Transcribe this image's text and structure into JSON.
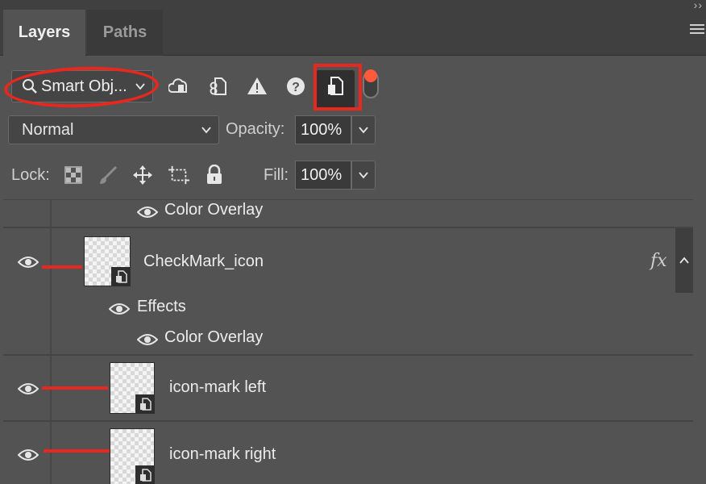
{
  "tabs": [
    {
      "label": "Layers",
      "active": true
    },
    {
      "label": "Paths",
      "active": false
    }
  ],
  "filter": {
    "kind_label": "Smart Obj...",
    "icons": [
      "cloud-update-icon",
      "linked-file-icon",
      "warning-icon",
      "question-icon",
      "smart-object-filter-icon"
    ],
    "active_icon": "smart-object-filter-icon",
    "toggle_on": true
  },
  "blend": {
    "mode": "Normal",
    "opacity_label": "Opacity:",
    "opacity_value": "100%"
  },
  "lock": {
    "label": "Lock:",
    "icons": [
      "lock-transparency-icon",
      "lock-paint-icon",
      "lock-position-icon",
      "lock-artboard-icon",
      "lock-all-icon"
    ],
    "fill_label": "Fill:",
    "fill_value": "100%"
  },
  "layers": {
    "partial_effect": "Color Overlay",
    "checkmark": {
      "name": "CheckMark_icon",
      "fx": "fx",
      "effects_label": "Effects",
      "effect": "Color Overlay"
    },
    "left": {
      "name": "icon-mark left"
    },
    "right": {
      "name": "icon-mark right"
    }
  },
  "colors": {
    "annotation_red": "#e8281e",
    "panel_bg": "#535353",
    "toggle_dot": "#ff5a3c"
  }
}
